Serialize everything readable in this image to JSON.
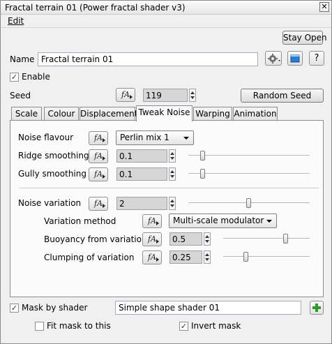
{
  "window": {
    "title": "Fractal terrain 01   (Power fractal shader v3)",
    "close_glyph": "✕"
  },
  "menu": {
    "edit": "Edit"
  },
  "header": {
    "stay_open": "Stay Open",
    "name_label": "Name",
    "name_value": "Fractal terrain 01",
    "help_glyph": "?",
    "enable_label": "Enable",
    "enable_checked": true,
    "seed_label": "Seed",
    "seed_value": "119",
    "random_seed": "Random Seed",
    "fa_glyph": "fA"
  },
  "tabs": [
    {
      "label": "Scale",
      "active": false
    },
    {
      "label": "Colour",
      "active": false
    },
    {
      "label": "Displacement",
      "active": false
    },
    {
      "label": "Tweak Noise",
      "active": true
    },
    {
      "label": "Warping",
      "active": false
    },
    {
      "label": "Animation",
      "active": false
    }
  ],
  "panel": {
    "noise_flavour_label": "Noise flavour",
    "noise_flavour_value": "Perlin mix 1",
    "ridge_smoothing_label": "Ridge smoothing",
    "ridge_smoothing_value": "0.1",
    "ridge_smoothing_level": 0.1,
    "gully_smoothing_label": "Gully smoothing",
    "gully_smoothing_value": "0.1",
    "gully_smoothing_level": 0.1,
    "noise_variation_label": "Noise variation",
    "noise_variation_value": "2",
    "noise_variation_level": 0.5,
    "variation_method_label": "Variation method",
    "variation_method_value": "Multi-scale modulator",
    "buoyancy_label": "Buoyancy from variation",
    "buoyancy_value": "0.5",
    "buoyancy_level": 0.75,
    "clumping_label": "Clumping of variation",
    "clumping_value": "0.25",
    "clumping_level": 0.25
  },
  "footer": {
    "mask_by_shader_label": "Mask by shader",
    "mask_by_shader_checked": true,
    "mask_shader_value": "Simple shape shader 01",
    "fit_mask_label": "Fit mask to this",
    "fit_mask_checked": false,
    "invert_mask_label": "Invert mask",
    "invert_mask_checked": true
  },
  "colors": {
    "accent_green": "#2e9a2e",
    "field_grey": "#d6d6d6"
  }
}
